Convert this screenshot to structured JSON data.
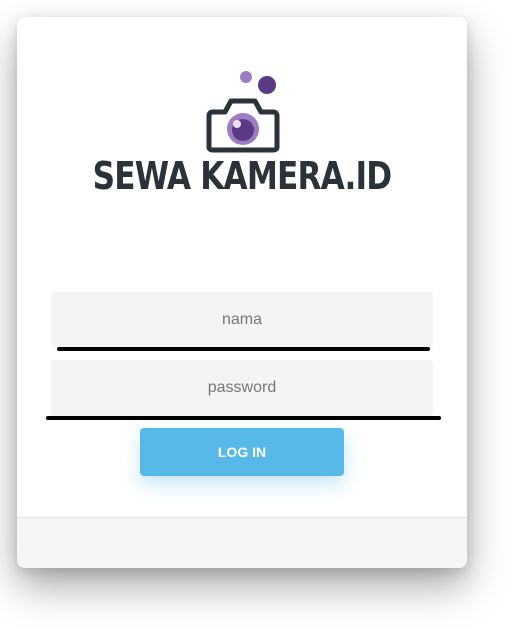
{
  "brand": {
    "name": "SEWA KAMERA.ID",
    "logo_icon": "camera-icon",
    "colors": {
      "text": "#2c3239",
      "lens_dark": "#5a3a82",
      "lens_light": "#9e7cc4"
    }
  },
  "form": {
    "username_placeholder": "nama",
    "password_placeholder": "password",
    "login_label": "LOG IN",
    "button_color": "#57b9ea"
  }
}
